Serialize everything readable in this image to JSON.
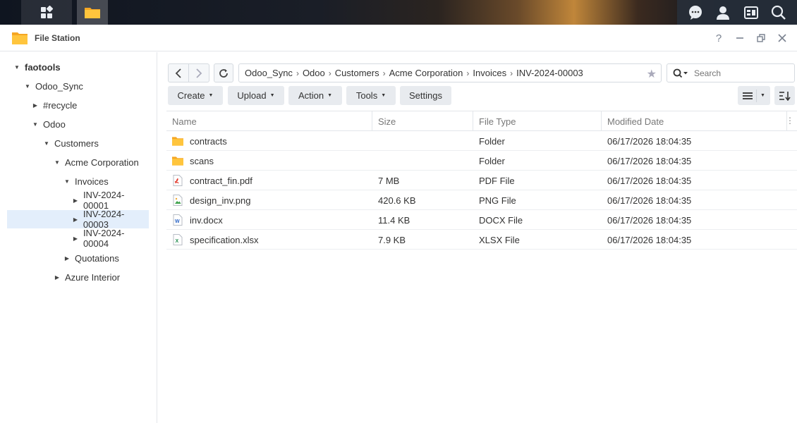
{
  "window": {
    "title": "File Station"
  },
  "sidebar": {
    "items": [
      {
        "label": "faotools",
        "depth": 0,
        "expanded": true
      },
      {
        "label": "Odoo_Sync",
        "depth": 1,
        "expanded": true
      },
      {
        "label": "#recycle",
        "depth": 2,
        "expanded": false
      },
      {
        "label": "Odoo",
        "depth": 2,
        "expanded": true
      },
      {
        "label": "Customers",
        "depth": 3,
        "expanded": true
      },
      {
        "label": "Acme Corporation",
        "depth": 4,
        "expanded": true
      },
      {
        "label": "Invoices",
        "depth": 5,
        "expanded": true
      },
      {
        "label": "INV-2024-00001",
        "depth": 6,
        "expanded": false
      },
      {
        "label": "INV-2024-00003",
        "depth": 6,
        "expanded": false,
        "selected": true
      },
      {
        "label": "INV-2024-00004",
        "depth": 6,
        "expanded": false
      },
      {
        "label": "Quotations",
        "depth": 5,
        "expanded": false
      },
      {
        "label": "Azure Interior",
        "depth": 4,
        "expanded": false
      }
    ]
  },
  "address": {
    "path": [
      "Odoo_Sync",
      "Odoo",
      "Customers",
      "Acme Corporation",
      "Invoices",
      "INV-2024-00003"
    ]
  },
  "search": {
    "placeholder": "Search"
  },
  "toolbar": {
    "create": "Create",
    "upload": "Upload",
    "action": "Action",
    "tools": "Tools",
    "settings": "Settings"
  },
  "table": {
    "columns": {
      "name": "Name",
      "size": "Size",
      "type": "File Type",
      "modified": "Modified Date"
    },
    "rows": [
      {
        "name": "contracts",
        "size": "",
        "type": "Folder",
        "modified": "06/17/2026 18:04:35",
        "icon": "folder-icon"
      },
      {
        "name": "scans",
        "size": "",
        "type": "Folder",
        "modified": "06/17/2026 18:04:35",
        "icon": "folder-icon"
      },
      {
        "name": "contract_fin.pdf",
        "size": "7 MB",
        "type": "PDF File",
        "modified": "06/17/2026 18:04:35",
        "icon": "pdf-icon"
      },
      {
        "name": "design_inv.png",
        "size": "420.6 KB",
        "type": "PNG File",
        "modified": "06/17/2026 18:04:35",
        "icon": "image-icon"
      },
      {
        "name": "inv.docx",
        "size": "11.4 KB",
        "type": "DOCX File",
        "modified": "06/17/2026 18:04:35",
        "icon": "word-icon"
      },
      {
        "name": "specification.xlsx",
        "size": "7.9 KB",
        "type": "XLSX File",
        "modified": "06/17/2026 18:04:35",
        "icon": "excel-icon"
      }
    ]
  },
  "colors": {
    "folder": "#f7b731",
    "selected": "#e3eefb",
    "accent": "#0086e5"
  }
}
